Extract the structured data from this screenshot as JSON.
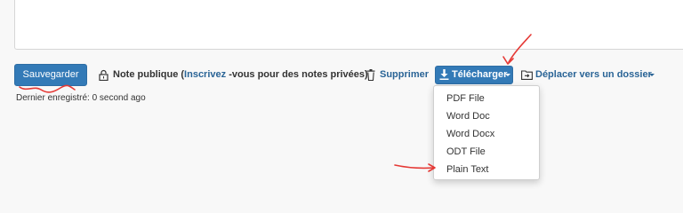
{
  "toolbar": {
    "save_label": "Sauvegarder",
    "public_note_prefix": "Note publique (",
    "signup_link": "Inscrivez",
    "public_note_suffix": " -vous pour des notes privées)",
    "delete_label": "Supprimer",
    "download_label": "Télécharger",
    "move_label": "Déplacer vers un dossier"
  },
  "status": {
    "last_saved": "Dernier enregistré: 0 second ago"
  },
  "download_menu": {
    "items": [
      "PDF File",
      "Word Doc",
      "Word Docx",
      "ODT File",
      "Plain Text"
    ]
  },
  "colors": {
    "primary": "#337ab7",
    "link": "#2a6496",
    "annotation": "#e53935"
  },
  "icons": [
    "lock-icon",
    "trash-icon",
    "download-icon",
    "folder-move-icon"
  ]
}
